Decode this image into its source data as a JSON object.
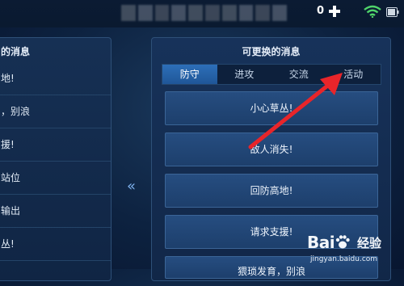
{
  "status_bar": {
    "count": "0",
    "plus_icon": "plus-icon",
    "wifi_icon": "wifi-icon",
    "battery_icon": "battery-icon"
  },
  "left_panel": {
    "title": "的消息",
    "items": [
      {
        "label": "地!"
      },
      {
        "label": "，别浪"
      },
      {
        "label": "援!"
      },
      {
        "label": "站位"
      },
      {
        "label": "输出"
      },
      {
        "label": "丛!"
      }
    ]
  },
  "transfer_button": {
    "label": "«",
    "icon": "double-chevron-left-icon"
  },
  "right_panel": {
    "title": "可更换的消息",
    "tabs": [
      {
        "label": "防守",
        "active": true
      },
      {
        "label": "进攻",
        "active": false
      },
      {
        "label": "交流",
        "active": false
      },
      {
        "label": "活动",
        "active": false
      }
    ],
    "options": [
      {
        "label": "小心草丛!"
      },
      {
        "label": "敌人消失!"
      },
      {
        "label": "回防高地!"
      },
      {
        "label": "请求支援!"
      },
      {
        "label": "猥琐发育，别浪"
      }
    ]
  },
  "annotation": {
    "color": "#e8252a"
  },
  "watermark": {
    "logo": "Bai",
    "brand": "经验",
    "url": "jingyan.baidu.com"
  },
  "colors": {
    "accent": "#2d6fb9",
    "background": "#0d2240"
  }
}
